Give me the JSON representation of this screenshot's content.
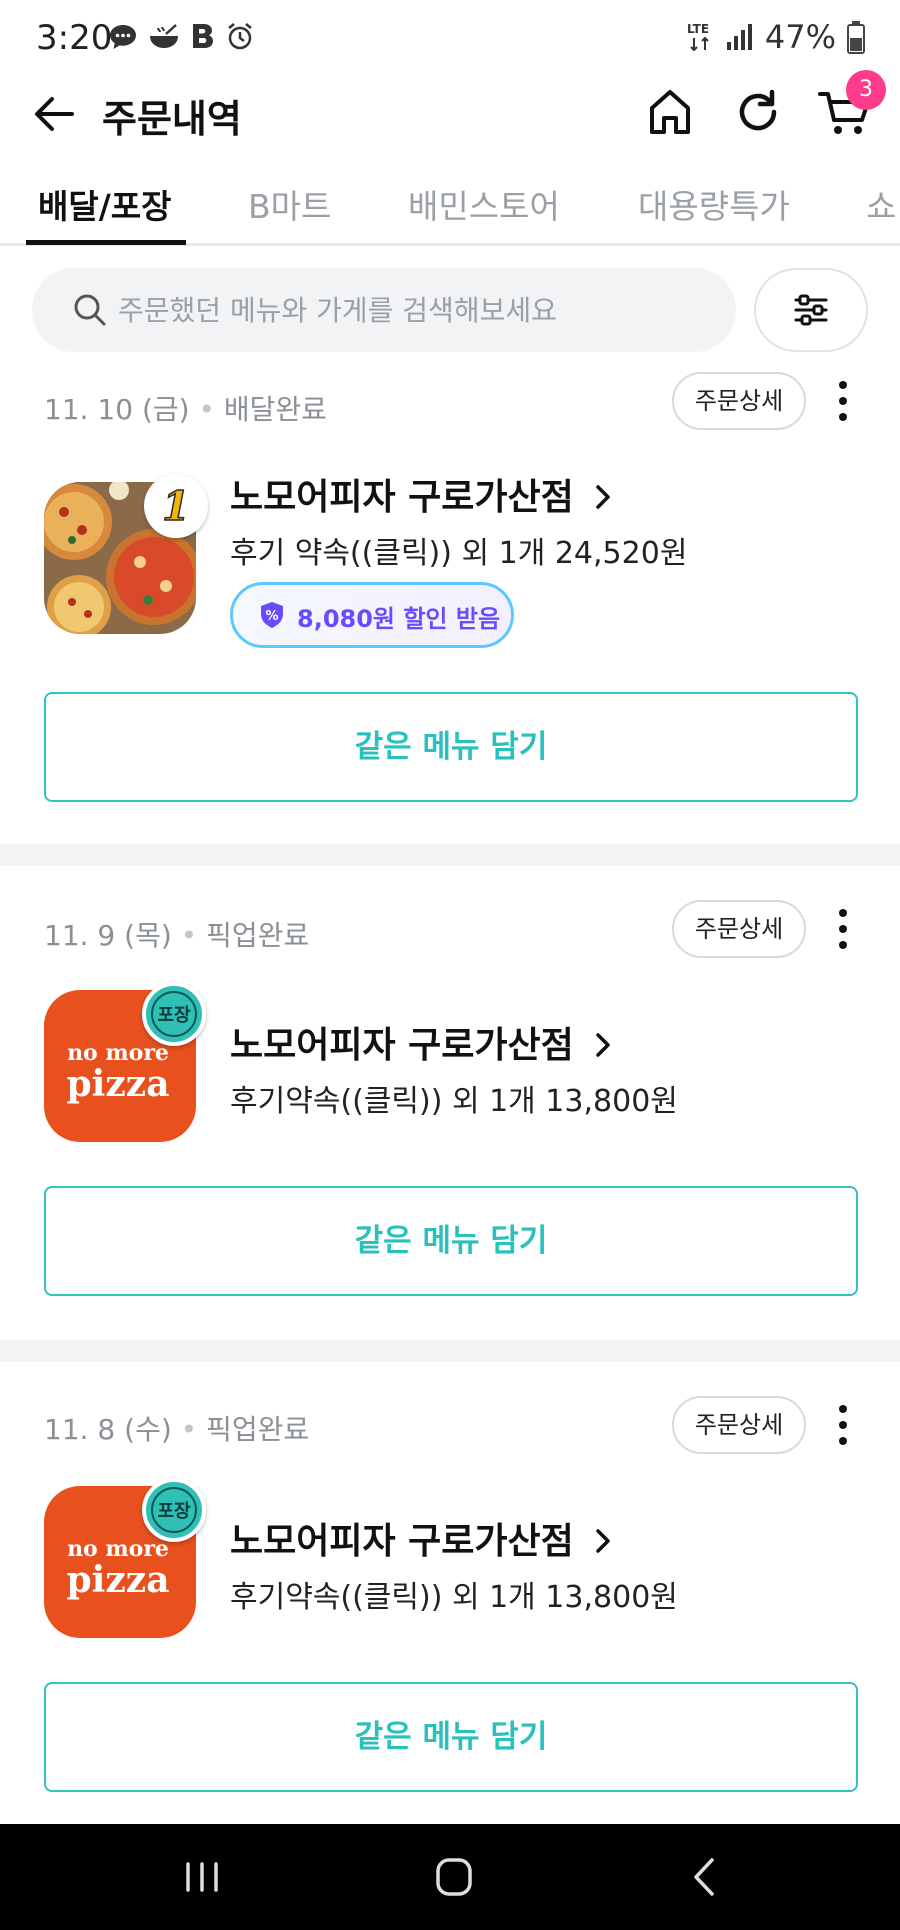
{
  "status_bar": {
    "time": "3:20",
    "network": "LTE",
    "battery": "47%",
    "icons": [
      "chat-icon",
      "bowl-icon",
      "b-app-icon",
      "alarm-icon"
    ]
  },
  "header": {
    "title": "주문내역",
    "cart_count": "3"
  },
  "tabs": [
    {
      "label": "배달/포장",
      "active": true
    },
    {
      "label": "B마트",
      "active": false
    },
    {
      "label": "배민스토어",
      "active": false
    },
    {
      "label": "대용량특가",
      "active": false
    },
    {
      "label": "쇼",
      "active": false
    }
  ],
  "search": {
    "placeholder": "주문했던 메뉴와 가게를 검색해보세요"
  },
  "orders": [
    {
      "date": "11. 10 (금)",
      "status": "배달완료",
      "detail_label": "주문상세",
      "store_name": "노모어피자 구로가산점",
      "summary": "후기 약속((클릭)) 외 1개 24,520원",
      "discount_label": "8,080원 할인 받음",
      "reorder_label": "같은 메뉴 담기",
      "thumb_badge": "1",
      "thumb_type": "pizza-photo"
    },
    {
      "date": "11. 9 (목)",
      "status": "픽업완료",
      "detail_label": "주문상세",
      "store_name": "노모어피자 구로가산점",
      "summary": "후기약속((클릭)) 외 1개 13,800원",
      "reorder_label": "같은 메뉴 담기",
      "thumb_badge": "포장",
      "thumb_logo_line1": "no more",
      "thumb_logo_line2": "pizza",
      "thumb_type": "logo"
    },
    {
      "date": "11. 8 (수)",
      "status": "픽업완료",
      "detail_label": "주문상세",
      "store_name": "노모어피자 구로가산점",
      "summary": "후기약속((클릭)) 외 1개 13,800원",
      "reorder_label": "같은 메뉴 담기",
      "thumb_badge": "포장",
      "thumb_logo_line1": "no more",
      "thumb_logo_line2": "pizza",
      "thumb_type": "logo"
    }
  ],
  "colors": {
    "accent": "#2ac1bc",
    "badge": "#ff3b8b",
    "discount": "#6a4cff",
    "logo_orange": "#e8501e"
  }
}
